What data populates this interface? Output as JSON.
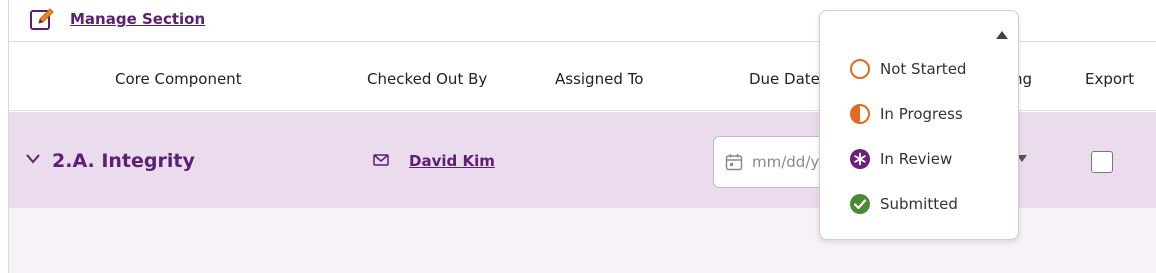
{
  "manage": {
    "label": "Manage Section",
    "icon": "edit-icon"
  },
  "columns": {
    "core_component": "Core Component",
    "checked_out_by": "Checked Out By",
    "assigned_to": "Assigned To",
    "due_date": "Due Date",
    "status_partial": "ng",
    "export": "Export"
  },
  "row": {
    "title": "2.A. Integrity",
    "checked_out_by": "David Kim",
    "due_date_placeholder": "mm/dd/yy",
    "export_checked": false
  },
  "status_menu": {
    "items": [
      {
        "label": "Not Started",
        "icon": "circle-outline-icon",
        "color": "#e06c1f"
      },
      {
        "label": "In Progress",
        "icon": "half-circle-icon",
        "color": "#e06c1f"
      },
      {
        "label": "In Review",
        "icon": "asterisk-circle-icon",
        "color": "#6b1f7a"
      },
      {
        "label": "Submitted",
        "icon": "check-circle-icon",
        "color": "#4a8a34"
      }
    ]
  },
  "colors": {
    "brand": "#5b1f73",
    "row_bg": "#eadcec",
    "lower_bg": "#f8f2f8"
  }
}
